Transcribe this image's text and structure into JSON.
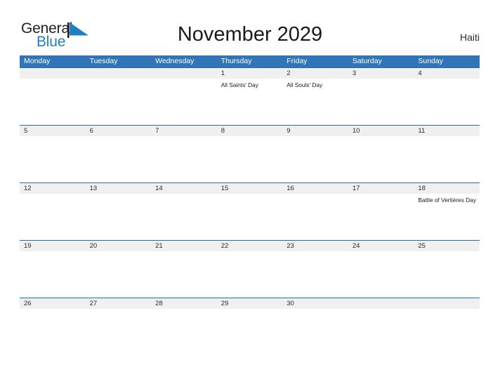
{
  "brand": {
    "name_part1": "General",
    "name_part2": "Blue",
    "flag_icon": "triangle-flag-icon",
    "accent_color": "#1f7fc4"
  },
  "header": {
    "title": "November 2029",
    "country": "Haiti"
  },
  "colors": {
    "header_blue": "#3075b8",
    "row_divider": "#2e6da4",
    "daynum_band": "#f0f0f0",
    "text": "#1a1a1a"
  },
  "calendar": {
    "weekdays": [
      "Monday",
      "Tuesday",
      "Wednesday",
      "Thursday",
      "Friday",
      "Saturday",
      "Sunday"
    ],
    "weeks": [
      {
        "days": [
          {
            "num": "",
            "event": ""
          },
          {
            "num": "",
            "event": ""
          },
          {
            "num": "",
            "event": ""
          },
          {
            "num": "1",
            "event": "All Saints' Day"
          },
          {
            "num": "2",
            "event": "All Souls' Day"
          },
          {
            "num": "3",
            "event": ""
          },
          {
            "num": "4",
            "event": ""
          }
        ]
      },
      {
        "days": [
          {
            "num": "5",
            "event": ""
          },
          {
            "num": "6",
            "event": ""
          },
          {
            "num": "7",
            "event": ""
          },
          {
            "num": "8",
            "event": ""
          },
          {
            "num": "9",
            "event": ""
          },
          {
            "num": "10",
            "event": ""
          },
          {
            "num": "11",
            "event": ""
          }
        ]
      },
      {
        "days": [
          {
            "num": "12",
            "event": ""
          },
          {
            "num": "13",
            "event": ""
          },
          {
            "num": "14",
            "event": ""
          },
          {
            "num": "15",
            "event": ""
          },
          {
            "num": "16",
            "event": ""
          },
          {
            "num": "17",
            "event": ""
          },
          {
            "num": "18",
            "event": "Battle of Vertières Day"
          }
        ]
      },
      {
        "days": [
          {
            "num": "19",
            "event": ""
          },
          {
            "num": "20",
            "event": ""
          },
          {
            "num": "21",
            "event": ""
          },
          {
            "num": "22",
            "event": ""
          },
          {
            "num": "23",
            "event": ""
          },
          {
            "num": "24",
            "event": ""
          },
          {
            "num": "25",
            "event": ""
          }
        ]
      },
      {
        "days": [
          {
            "num": "26",
            "event": ""
          },
          {
            "num": "27",
            "event": ""
          },
          {
            "num": "28",
            "event": ""
          },
          {
            "num": "29",
            "event": ""
          },
          {
            "num": "30",
            "event": ""
          },
          {
            "num": "",
            "event": ""
          },
          {
            "num": "",
            "event": ""
          }
        ]
      }
    ]
  }
}
